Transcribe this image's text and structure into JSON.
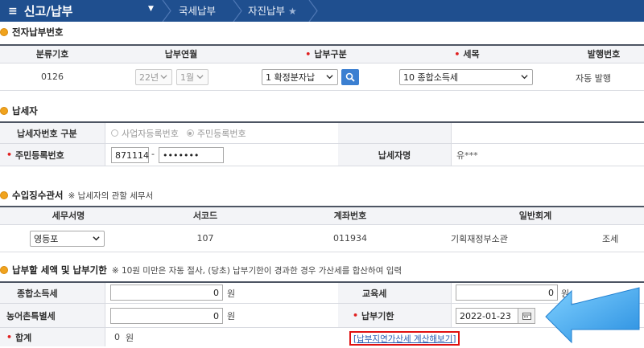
{
  "nav": {
    "menu_title": "신고/납부",
    "crumbs": [
      "국세납부",
      "자진납부"
    ],
    "colors": {
      "bar": "#1f4f8f",
      "accent": "#3b7fd1"
    }
  },
  "electronic_payment": {
    "title": "전자납부번호",
    "headers": {
      "class_code": "분류기호",
      "pay_period": "납부연월",
      "pay_type": "납부구분",
      "tax_item": "세목",
      "issue_no": "발행번호"
    },
    "values": {
      "class_code": "0126",
      "year": "22년",
      "month": "1월",
      "pay_type": "1 확정분자납",
      "tax_item": "10 종합소득세",
      "issue_no": "자동 발행"
    }
  },
  "taxpayer": {
    "title": "납세자",
    "id_type_label": "납세자번호 구분",
    "id_type_options": [
      "사업자등록번호",
      "주민등록번호"
    ],
    "rrn_label": "주민등록번호",
    "rrn_front": "871114",
    "rrn_dash": "-",
    "rrn_back": "•••••••",
    "name_label": "납세자명",
    "name_value": "유***"
  },
  "tax_office": {
    "title": "수입징수관서",
    "note": "※ 납세자의 관할 세무서",
    "headers": {
      "office": "세무서명",
      "code": "서코드",
      "account": "계좌번호",
      "general": "일반회계"
    },
    "values": {
      "office": "영등포",
      "code": "107",
      "account": "011934",
      "dept": "기획재정부소관",
      "type": "조세"
    }
  },
  "amount": {
    "title": "납부할 세액 및 납부기한",
    "note": "※ 10원 미만은 자동 절사, (당초) 납부기한이 경과한 경우 가산세를 합산하여 입력",
    "income_tax_label": "종합소득세",
    "income_tax_value": "0",
    "rural_tax_label": "농어촌특별세",
    "rural_tax_value": "0",
    "edu_tax_label": "교육세",
    "edu_tax_value": "0",
    "due_label": "납부기한",
    "due_value": "2022-01-23",
    "total_label": "합계",
    "total_value": "0",
    "unit": "원",
    "calc_link": "[납부지연가산세 계산해보기]"
  }
}
